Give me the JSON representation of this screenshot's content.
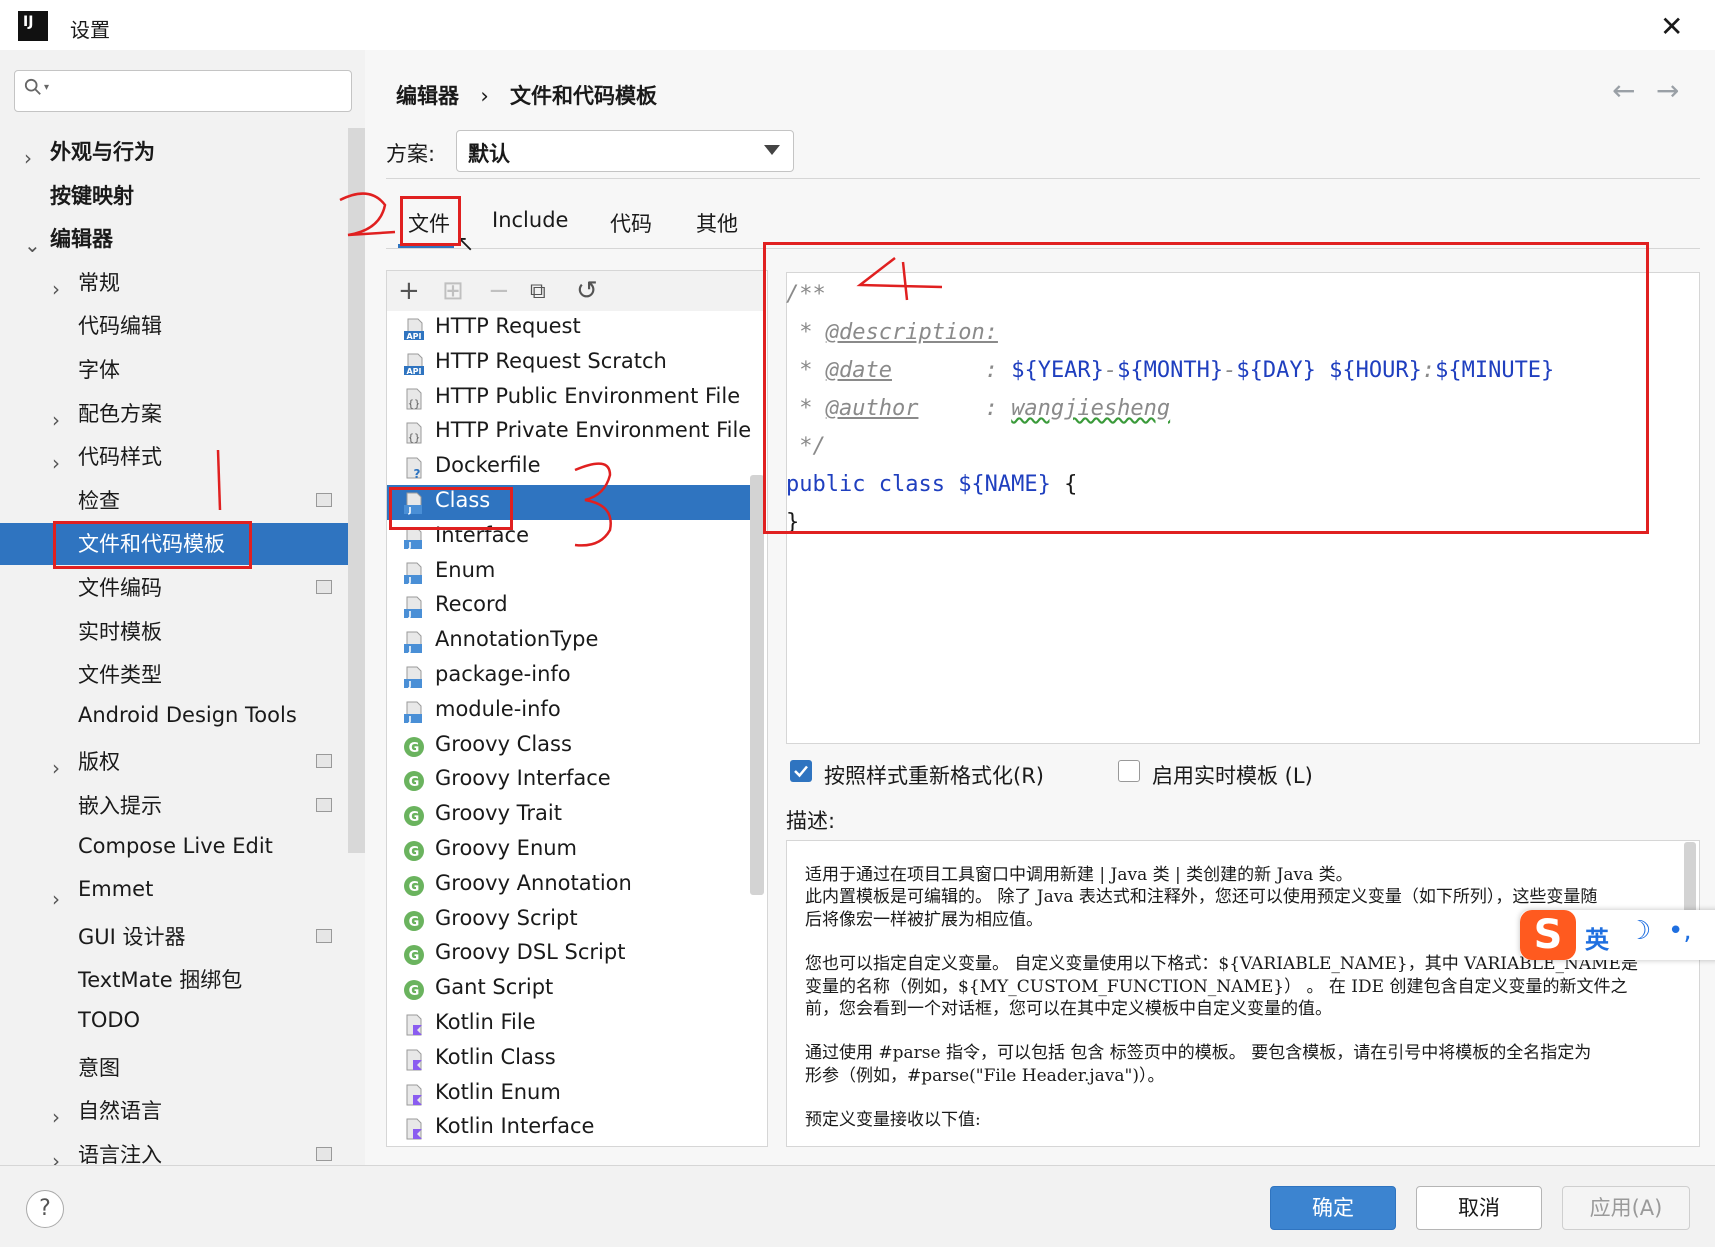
{
  "window": {
    "title": "设置",
    "app_icon_text": "IJ"
  },
  "sidebar": {
    "items": [
      {
        "label": "外观与行为",
        "bold": true,
        "expandable": true,
        "indent": 0
      },
      {
        "label": "按键映射",
        "bold": true,
        "expandable": false,
        "indent": 0
      },
      {
        "label": "编辑器",
        "bold": true,
        "expandable": true,
        "expanded": true,
        "indent": 0
      },
      {
        "label": "常规",
        "expandable": true,
        "indent": 1
      },
      {
        "label": "代码编辑",
        "indent": 1
      },
      {
        "label": "字体",
        "indent": 1
      },
      {
        "label": "配色方案",
        "expandable": true,
        "indent": 1
      },
      {
        "label": "代码样式",
        "expandable": true,
        "indent": 1
      },
      {
        "label": "检查",
        "indent": 1,
        "page_icon": true
      },
      {
        "label": "文件和代码模板",
        "indent": 1,
        "selected": true
      },
      {
        "label": "文件编码",
        "indent": 1,
        "page_icon": true
      },
      {
        "label": "实时模板",
        "indent": 1
      },
      {
        "label": "文件类型",
        "indent": 1
      },
      {
        "label": "Android Design Tools",
        "indent": 1
      },
      {
        "label": "版权",
        "expandable": true,
        "indent": 1,
        "page_icon": true
      },
      {
        "label": "嵌入提示",
        "indent": 1,
        "page_icon": true
      },
      {
        "label": "Compose Live Edit",
        "indent": 1
      },
      {
        "label": "Emmet",
        "expandable": true,
        "indent": 1
      },
      {
        "label": "GUI 设计器",
        "indent": 1,
        "page_icon": true
      },
      {
        "label": "TextMate 捆绑包",
        "indent": 1
      },
      {
        "label": "TODO",
        "indent": 1
      },
      {
        "label": "意图",
        "indent": 1
      },
      {
        "label": "自然语言",
        "expandable": true,
        "indent": 1
      },
      {
        "label": "语言注入",
        "expandable": true,
        "indent": 1,
        "page_icon": true
      }
    ]
  },
  "breadcrumb": {
    "parent": "编辑器",
    "separator": "›",
    "current": "文件和代码模板"
  },
  "scheme": {
    "label": "方案:",
    "value": "默认"
  },
  "tabs": [
    "文件",
    "Include",
    "代码",
    "其他"
  ],
  "templates": [
    {
      "label": "HTTP Request",
      "icon": "api"
    },
    {
      "label": "HTTP Request Scratch",
      "icon": "api"
    },
    {
      "label": "HTTP Public Environment File",
      "icon": "json"
    },
    {
      "label": "HTTP Private Environment File",
      "icon": "json"
    },
    {
      "label": "Dockerfile",
      "icon": "docker"
    },
    {
      "label": "Class",
      "icon": "java",
      "selected": true
    },
    {
      "label": "Interface",
      "icon": "java"
    },
    {
      "label": "Enum",
      "icon": "java"
    },
    {
      "label": "Record",
      "icon": "java"
    },
    {
      "label": "AnnotationType",
      "icon": "java"
    },
    {
      "label": "package-info",
      "icon": "java"
    },
    {
      "label": "module-info",
      "icon": "java"
    },
    {
      "label": "Groovy Class",
      "icon": "groovy"
    },
    {
      "label": "Groovy Interface",
      "icon": "groovy"
    },
    {
      "label": "Groovy Trait",
      "icon": "groovy"
    },
    {
      "label": "Groovy Enum",
      "icon": "groovy"
    },
    {
      "label": "Groovy Annotation",
      "icon": "groovy"
    },
    {
      "label": "Groovy Script",
      "icon": "groovy"
    },
    {
      "label": "Groovy DSL Script",
      "icon": "groovy"
    },
    {
      "label": "Gant Script",
      "icon": "groovy"
    },
    {
      "label": "Kotlin File",
      "icon": "kotlin"
    },
    {
      "label": "Kotlin Class",
      "icon": "kotlin"
    },
    {
      "label": "Kotlin Enum",
      "icon": "kotlin"
    },
    {
      "label": "Kotlin Interface",
      "icon": "kotlin"
    }
  ],
  "editor": {
    "line1": "/**",
    "desc_star": " * ",
    "desc_tag": "@description:",
    "date_star": " * ",
    "date_tag": "@date",
    "date_colon": "       : ",
    "v_year": "${YEAR}",
    "dash": "-",
    "v_month": "${MONTH}",
    "v_day": "${DAY}",
    "space": " ",
    "v_hour": "${HOUR}",
    "colon": ":",
    "v_minute": "${MINUTE}",
    "author_star": " * ",
    "author_tag": "@author",
    "author_colon": "     : ",
    "author_value": "wangjiesheng",
    "close_comment": " */",
    "public_class": "public class ",
    "v_name": "${NAME}",
    "brace_open": " {",
    "brace_close": "}"
  },
  "options": {
    "reformat_label": "按照样式重新格式化(R)",
    "reformat_checked": true,
    "live_template_label": "启用实时模板 (L)",
    "live_template_checked": false
  },
  "description": {
    "label": "描述:",
    "lines": [
      "适用于通过在项目工具窗口中调用新建 | Java 类 | 类创建的新 Java 类。",
      "此内置模板是可编辑的。 除了 Java 表达式和注释外，您还可以使用预定义变量（如下所列），这些变量随",
      "后将像宏一样被扩展为相应值。",
      "",
      "您也可以指定自定义变量。 自定义变量使用以下格式：${VARIABLE_NAME}，其中 VARIABLE_NAME是",
      "变量的名称（例如，${MY_CUSTOM_FUNCTION_NAME}） 。 在 IDE 创建包含自定义变量的新文件之",
      "前，您会看到一个对话框，您可以在其中定义模板中自定义变量的值。",
      "",
      "通过使用 #parse 指令，可以包括 包含 标签页中的模板。 要包含模板，请在引号中将模板的全名指定为",
      "形参（例如，#parse(\"File Header.java\")）。",
      "",
      "预定义变量接收以下值:"
    ]
  },
  "buttons": {
    "ok": "确定",
    "cancel": "取消",
    "apply": "应用(A)",
    "help": "?"
  },
  "annotations": {
    "n1": "1",
    "n2": "2",
    "n3": "3",
    "n4": "4"
  },
  "ime": {
    "logo": "S",
    "mode": "英",
    "moon": "☽",
    "punct": "•,"
  },
  "colors": {
    "accent": "#2f74c0",
    "annotation_red": "#e02020",
    "code_var": "#1f3fbf"
  }
}
